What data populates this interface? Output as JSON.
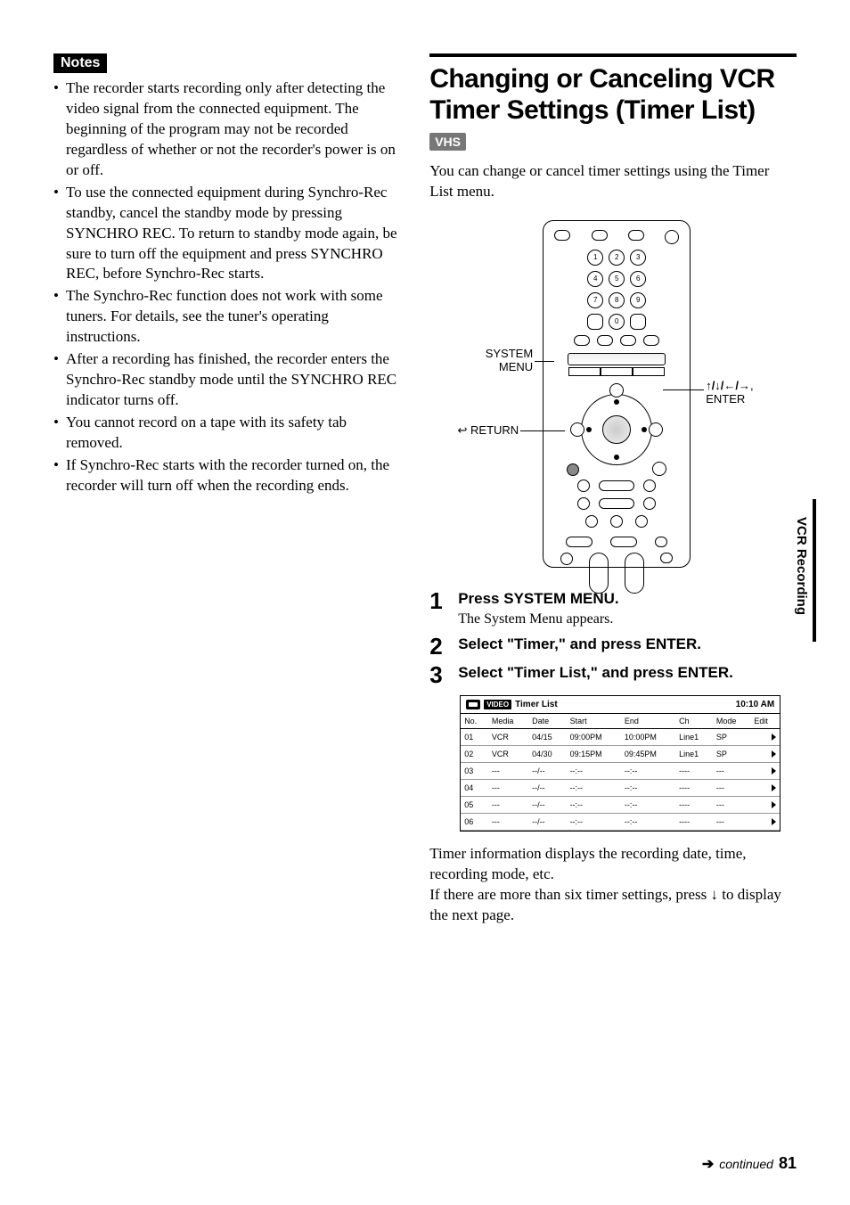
{
  "left": {
    "notes_label": "Notes",
    "bullets": [
      "The recorder starts recording only after detecting the video signal from the connected equipment. The beginning of the program may not be recorded regardless of whether or not the recorder's power is on or off.",
      "To use the connected equipment during Synchro-Rec standby, cancel the standby mode by pressing SYNCHRO REC. To return to standby mode again, be sure to turn off the equipment and press SYNCHRO REC, before Synchro-Rec starts.",
      "The Synchro-Rec function does not work with some tuners. For details, see the tuner's operating instructions.",
      "After a recording has finished, the recorder enters the Synchro-Rec standby mode until the SYNCHRO REC indicator turns off.",
      "You cannot record on a tape with its safety tab removed.",
      "If Synchro-Rec starts with the recorder turned on, the recorder will turn off when the recording ends."
    ]
  },
  "right": {
    "section_title": "Changing or Canceling VCR Timer Settings (Timer List)",
    "vhs_badge": "VHS",
    "intro": "You can change or cancel timer settings using the Timer List menu.",
    "callouts": {
      "system_menu": "SYSTEM MENU",
      "return": "RETURN",
      "dpad_enter": "↑/↓/←/→, ENTER"
    },
    "remote_numbers": [
      "1",
      "2",
      "3",
      "4",
      "5",
      "6",
      "7",
      "8",
      "9",
      "",
      "0",
      ""
    ],
    "steps": [
      {
        "num": "1",
        "head": "Press SYSTEM MENU.",
        "desc": "The System Menu appears."
      },
      {
        "num": "2",
        "head": "Select \"Timer,\" and press ENTER.",
        "desc": ""
      },
      {
        "num": "3",
        "head": "Select \"Timer List,\" and press ENTER.",
        "desc": ""
      }
    ],
    "timer_list": {
      "video_badge": "VIDEO",
      "title": "Timer List",
      "clock": "10:10 AM",
      "columns": [
        "No.",
        "Media",
        "Date",
        "Start",
        "End",
        "Ch",
        "Mode",
        "Edit"
      ],
      "rows": [
        {
          "no": "01",
          "media": "VCR",
          "date": "04/15",
          "start": "09:00PM",
          "end": "10:00PM",
          "ch": "Line1",
          "mode": "SP"
        },
        {
          "no": "02",
          "media": "VCR",
          "date": "04/30",
          "start": "09:15PM",
          "end": "09:45PM",
          "ch": "Line1",
          "mode": "SP"
        },
        {
          "no": "03",
          "media": "---",
          "date": "--/--",
          "start": "--:--",
          "end": "--:--",
          "ch": "----",
          "mode": "---"
        },
        {
          "no": "04",
          "media": "---",
          "date": "--/--",
          "start": "--:--",
          "end": "--:--",
          "ch": "----",
          "mode": "---"
        },
        {
          "no": "05",
          "media": "---",
          "date": "--/--",
          "start": "--:--",
          "end": "--:--",
          "ch": "----",
          "mode": "---"
        },
        {
          "no": "06",
          "media": "---",
          "date": "--/--",
          "start": "--:--",
          "end": "--:--",
          "ch": "----",
          "mode": "---"
        }
      ]
    },
    "after_table_1": "Timer information displays the recording date, time, recording mode, etc.",
    "after_table_2a": "If there are more than six timer settings, press ",
    "after_table_2b": " to display the next page.",
    "down_arrow": "↓"
  },
  "sidetab": "VCR Recording",
  "footer": {
    "arrow": "➔",
    "continued": "continued",
    "page": "81"
  }
}
